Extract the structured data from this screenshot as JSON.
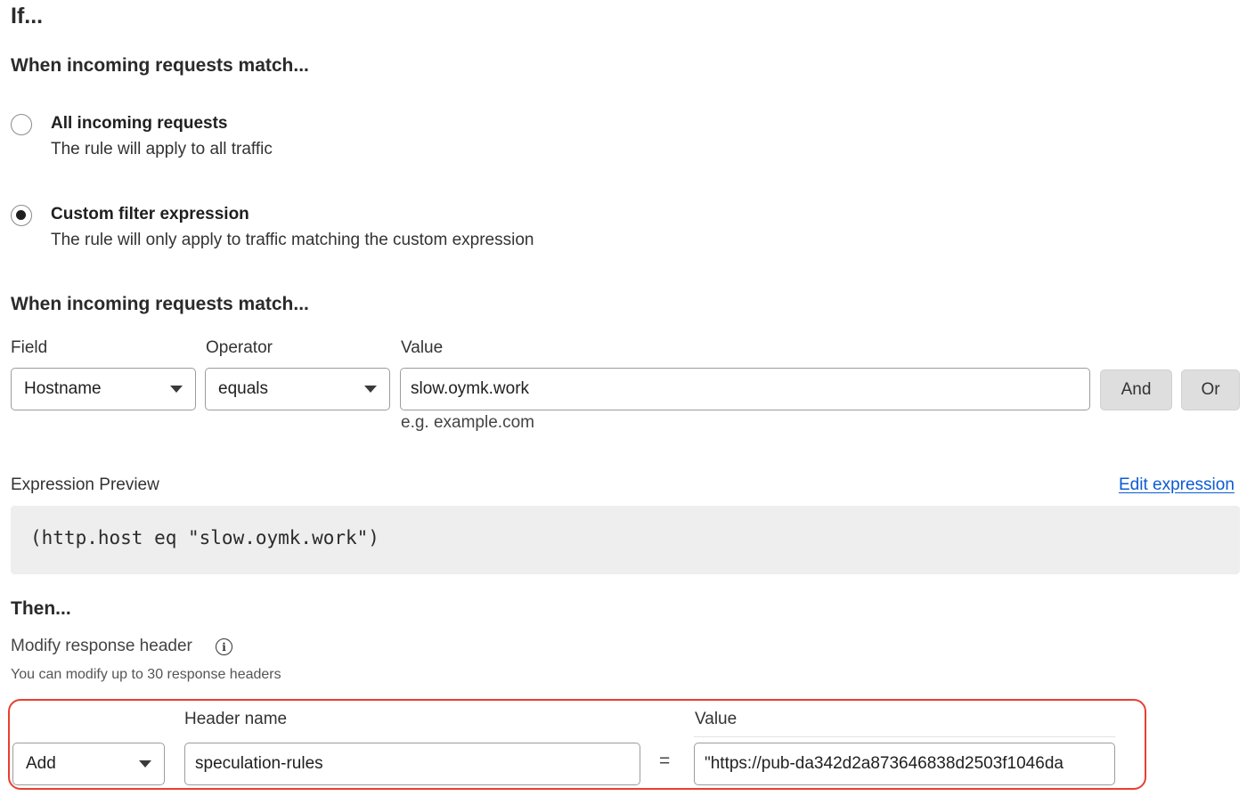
{
  "if_heading": "If...",
  "match_heading_1": "When incoming requests match...",
  "options": [
    {
      "title": "All incoming requests",
      "description": "The rule will apply to all traffic",
      "checked": false
    },
    {
      "title": "Custom filter expression",
      "description": "The rule will only apply to traffic matching the custom expression",
      "checked": true
    }
  ],
  "match_heading_2": "When incoming requests match...",
  "filter": {
    "field_label": "Field",
    "operator_label": "Operator",
    "value_label": "Value",
    "field_value": "Hostname",
    "operator_value": "equals",
    "value_value": "slow.oymk.work",
    "value_hint": "e.g. example.com",
    "and_label": "And",
    "or_label": "Or"
  },
  "expression": {
    "label": "Expression Preview",
    "edit_label": "Edit expression",
    "code": "(http.host eq \"slow.oymk.work\")"
  },
  "then": {
    "heading": "Then...",
    "subheading": "Modify response header",
    "note": "You can modify up to 30 response headers",
    "header_name_label": "Header name",
    "value_label": "Value",
    "action_value": "Add",
    "header_name_value": "speculation-rules",
    "equals_sign": "=",
    "header_value": "\"https://pub-da342d2a873646838d2503f1046da"
  },
  "colors": {
    "link": "#0b5bd3",
    "highlight": "#e8402e"
  }
}
